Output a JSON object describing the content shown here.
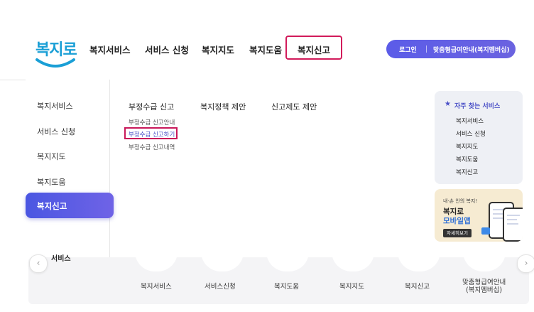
{
  "logo": {
    "text": "복지로"
  },
  "gnb": {
    "items": [
      "복지서비스",
      "서비스 신청",
      "복지지도",
      "복지도움",
      "복지신고"
    ]
  },
  "top": {
    "login": "로그인",
    "custom": "맞춤형급여안내(복지멤버십)"
  },
  "left_menu": {
    "items": [
      "복지서비스",
      "서비스 신청",
      "복지지도",
      "복지도움"
    ],
    "active": "복지신고"
  },
  "submenu": {
    "heads": [
      "부정수급 신고",
      "복지정책 제안",
      "신고제도 제안"
    ],
    "links": [
      "부정수급 신고안내",
      "부정수급 신고하기",
      "부정수급 신고내역"
    ]
  },
  "favorites": {
    "title": "자주 찾는 서비스",
    "items": [
      "복지서비스",
      "서비스 신청",
      "복지지도",
      "복지도움",
      "복지신고"
    ]
  },
  "mobile": {
    "small": "내·손 안의 복지!",
    "line1": "복지로",
    "line2": "모바일앱",
    "button": "자세히보기"
  },
  "bottom": {
    "blur_text": "서비스",
    "labels": [
      "복지서비스",
      "서비스신청",
      "복지도움",
      "복지지도",
      "복지신고"
    ],
    "last_label_1": "맞춤형급여안내",
    "last_label_2": "(복지멤버십)",
    "prev": "‹",
    "next": "›"
  },
  "colors": {
    "accent": "#5b5ce8",
    "highlight": "#d21b5b",
    "logo": "#1a9fd6"
  }
}
